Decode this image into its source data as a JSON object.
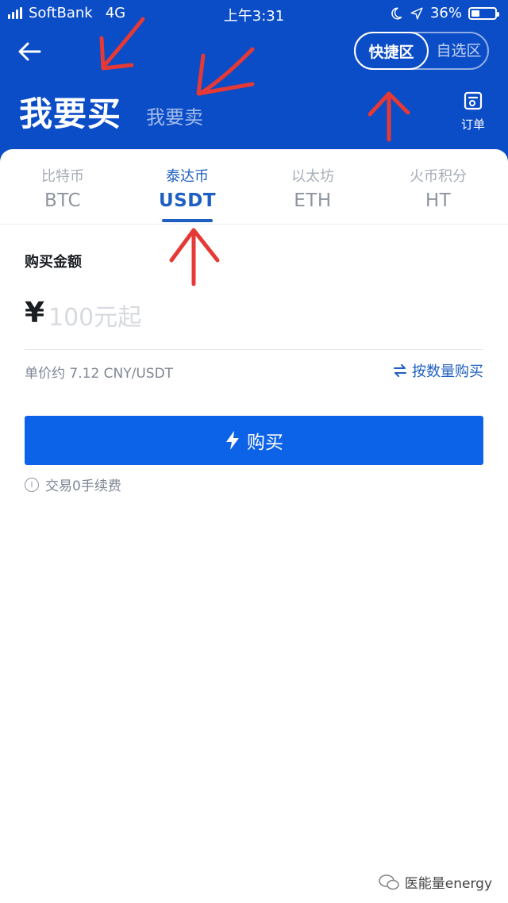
{
  "status_bar": {
    "carrier": "SoftBank",
    "network": "4G",
    "time": "上午3:31",
    "battery": "36%",
    "battery_level": 0.36
  },
  "header": {
    "title": "我要买",
    "sell_tab": "我要卖",
    "orders_label": "订单"
  },
  "mode_toggle": {
    "quick": "快捷区",
    "custom": "自选区"
  },
  "coin_tabs": [
    {
      "cn": "比特币",
      "symbol": "BTC",
      "active": false
    },
    {
      "cn": "泰达币",
      "symbol": "USDT",
      "active": true
    },
    {
      "cn": "以太坊",
      "symbol": "ETH",
      "active": false
    },
    {
      "cn": "火币积分",
      "symbol": "HT",
      "active": false
    }
  ],
  "form": {
    "amount_label": "购买金额",
    "currency_symbol": "¥",
    "amount_placeholder": "100元起",
    "unit_price": "单价约 7.12 CNY/USDT",
    "switch_label": "按数量购买",
    "buy_label": "购买",
    "fee_note": "交易0手续费"
  },
  "watermark": "医能量energy",
  "colors": {
    "header_bg": "#0b4cc7",
    "primary": "#0c63e7",
    "accent_text": "#1e5fc1",
    "annotation": "#e53935"
  }
}
